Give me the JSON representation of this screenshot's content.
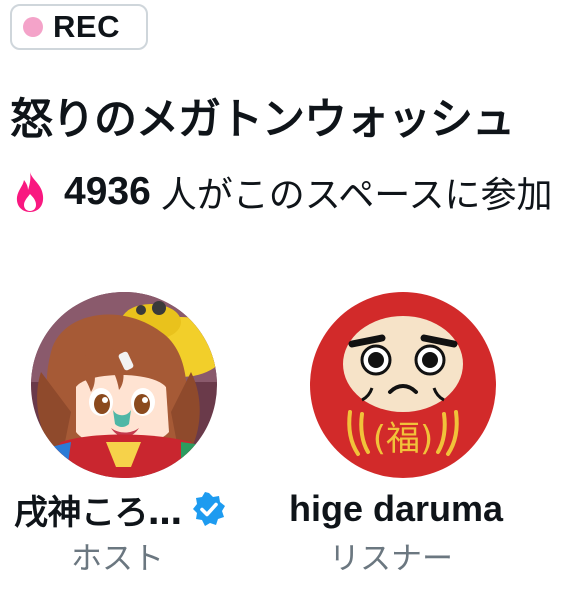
{
  "recording": {
    "label": "REC",
    "dot_color": "#f4a3c9"
  },
  "space": {
    "title": "怒りのメガトンウォッシュ",
    "participant_icon": "fire-icon",
    "participant_count": "4936",
    "participant_text": "人がこのスペースに参加"
  },
  "participants": [
    {
      "name": "戌神ころ…",
      "role": "ホスト",
      "verified": true,
      "avatar": "anime-girl-avatar"
    },
    {
      "name": "hige daruma",
      "role": "リスナー",
      "verified": false,
      "avatar": "daruma-avatar"
    }
  ],
  "colors": {
    "accent": "#1d9bf0",
    "fire": "#f91880",
    "secondary_text": "#6b7780"
  }
}
